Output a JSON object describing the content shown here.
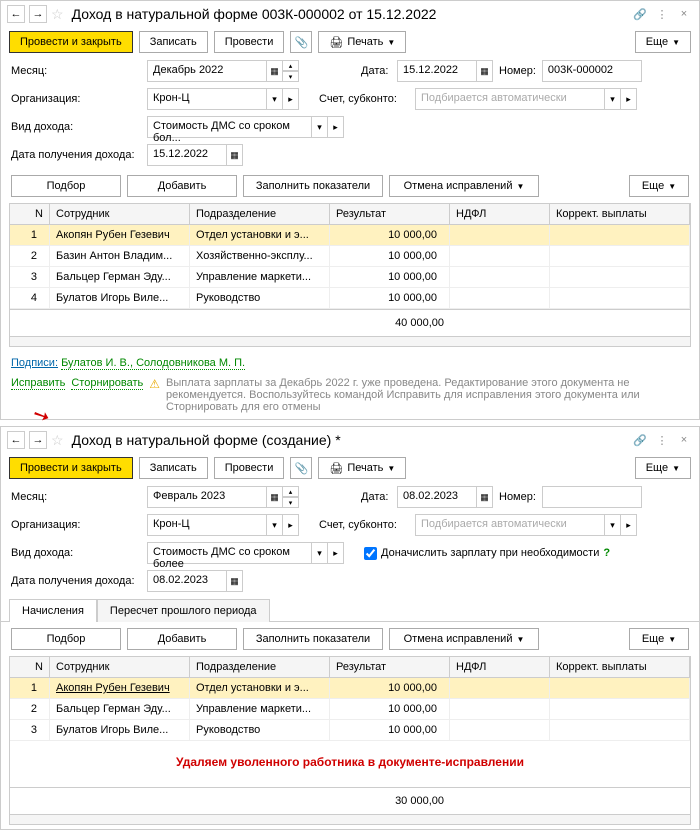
{
  "top": {
    "title": "Доход в натуральной форме 003К-000002 от 15.12.2022",
    "toolbar": {
      "primary": "Провести и закрыть",
      "save": "Записать",
      "post": "Провести",
      "print": "Печать",
      "more": "Еще"
    },
    "month_label": "Месяц:",
    "month": "Декабрь 2022",
    "date_label": "Дата:",
    "date": "15.12.2022",
    "number_label": "Номер:",
    "number": "003К-000002",
    "org_label": "Организация:",
    "org": "Крон-Ц",
    "account_label": "Счет, субконто:",
    "account_placeholder": "Подбирается автоматически",
    "type_label": "Вид дохода:",
    "type": "Стоимость ДМС со сроком бол...",
    "receive_label": "Дата получения дохода:",
    "receive": "15.12.2022",
    "table_toolbar": {
      "select": "Подбор",
      "add": "Добавить",
      "fill": "Заполнить показатели",
      "cancel": "Отмена исправлений",
      "more": "Еще"
    },
    "columns": {
      "n": "N",
      "emp": "Сотрудник",
      "dep": "Подразделение",
      "res": "Результат",
      "ndfl": "НДФЛ",
      "corr": "Коррект. выплаты"
    },
    "rows": [
      {
        "n": "1",
        "emp": "Акопян Рубен Гезевич",
        "dep": "Отдел установки и э...",
        "res": "10 000,00",
        "selected": true
      },
      {
        "n": "2",
        "emp": "Базин Антон Владим...",
        "dep": "Хозяйственно-эксплу...",
        "res": "10 000,00"
      },
      {
        "n": "3",
        "emp": "Бальцер Герман Эду...",
        "dep": "Управление маркети...",
        "res": "10 000,00"
      },
      {
        "n": "4",
        "emp": "Булатов Игорь Виле...",
        "dep": "Руководство",
        "res": "10 000,00"
      }
    ],
    "total": "40 000,00",
    "signatures_label": "Подписи:",
    "signatures": "Булатов И. В., Солодовникова М. П.",
    "correct": "Исправить",
    "storno": "Сторнировать",
    "warning": "Выплата зарплаты за Декабрь 2022 г. уже проведена. Редактирование этого документа не рекомендуется. Воспользуйтесь командой Исправить для исправления этого документа или Сторнировать для его отмены"
  },
  "bottom": {
    "title": "Доход в натуральной форме (создание) *",
    "toolbar": {
      "primary": "Провести и закрыть",
      "save": "Записать",
      "post": "Провести",
      "print": "Печать",
      "more": "Еще"
    },
    "month_label": "Месяц:",
    "month": "Февраль 2023",
    "date_label": "Дата:",
    "date": "08.02.2023",
    "number_label": "Номер:",
    "number": "",
    "org_label": "Организация:",
    "org": "Крон-Ц",
    "account_label": "Счет, субконто:",
    "account_placeholder": "Подбирается автоматически",
    "additional_label": "Доначислить зарплату при необходимости",
    "type_label": "Вид дохода:",
    "type": "Стоимость ДМС со сроком более",
    "receive_label": "Дата получения дохода:",
    "receive": "08.02.2023",
    "tabs": {
      "calc": "Начисления",
      "recalc": "Пересчет прошлого периода"
    },
    "table_toolbar": {
      "select": "Подбор",
      "add": "Добавить",
      "fill": "Заполнить показатели",
      "cancel": "Отмена исправлений",
      "more": "Еще"
    },
    "columns": {
      "n": "N",
      "emp": "Сотрудник",
      "dep": "Подразделение",
      "res": "Результат",
      "ndfl": "НДФЛ",
      "corr": "Коррект. выплаты"
    },
    "rows": [
      {
        "n": "1",
        "emp": "Акопян Рубен Гезевич",
        "dep": "Отдел установки и э...",
        "res": "10 000,00",
        "selected": true,
        "emp_link": true
      },
      {
        "n": "2",
        "emp": "Бальцер Герман Эду...",
        "dep": "Управление маркети...",
        "res": "10 000,00"
      },
      {
        "n": "3",
        "emp": "Булатов Игорь Виле...",
        "dep": "Руководство",
        "res": "10 000,00"
      }
    ],
    "note": "Удаляем уволенного работника в документе-исправлении",
    "total": "30 000,00"
  }
}
